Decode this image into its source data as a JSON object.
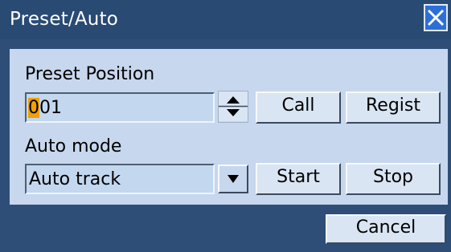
{
  "window": {
    "title": "Preset/Auto"
  },
  "preset": {
    "section_label": "Preset Position",
    "position_value_cursor": "0",
    "position_value_rest": "01",
    "call_label": "Call",
    "regist_label": "Regist"
  },
  "auto": {
    "section_label": "Auto mode",
    "mode_value": "Auto track",
    "start_label": "Start",
    "stop_label": "Stop"
  },
  "footer": {
    "cancel_label": "Cancel"
  },
  "icons": {
    "close": "close-icon",
    "spinner": "up-down-spinner-icon",
    "dropdown": "triangle-down-icon"
  },
  "colors": {
    "frame": "#2e4e78",
    "panel": "#c7d7ee",
    "button_face": "#d9e5f3",
    "close_button": "#2c6fd8",
    "cursor_highlight": "#f0a000"
  }
}
